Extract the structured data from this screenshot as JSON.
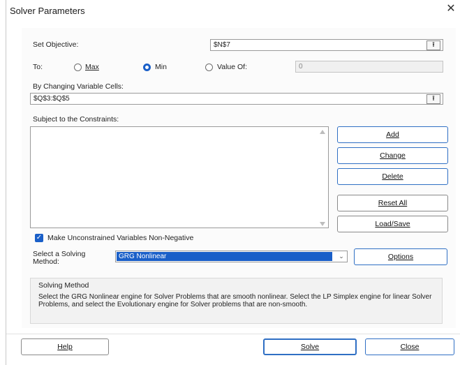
{
  "window": {
    "title": "Solver Parameters",
    "close_glyph": "✕"
  },
  "objective": {
    "label": "Set Objective:",
    "value": "$N$7",
    "ref_icon": "range-select-icon"
  },
  "to": {
    "label": "To:",
    "options": [
      {
        "label": "Max",
        "selected": false
      },
      {
        "label": "Min",
        "selected": true
      },
      {
        "label": "Value Of:",
        "selected": false
      }
    ],
    "value_of": "0"
  },
  "changing_cells": {
    "label": "By Changing Variable Cells:",
    "value": "$Q$3:$Q$5"
  },
  "constraints": {
    "label": "Subject to the Constraints:",
    "items": []
  },
  "buttons": {
    "add": "Add",
    "change": "Change",
    "delete": "Delete",
    "reset_all": "Reset All",
    "load_save": "Load/Save",
    "options": "Options",
    "help": "Help",
    "solve": "Solve",
    "close": "Close"
  },
  "nonnegative": {
    "label": "Make Unconstrained Variables Non-Negative",
    "checked": true
  },
  "method": {
    "label_line1": "Select a Solving",
    "label_line2": "Method:",
    "selected": "GRG Nonlinear"
  },
  "solving_method": {
    "title": "Solving Method",
    "text": "Select the GRG Nonlinear engine for Solver Problems that are smooth nonlinear. Select the LP Simplex engine for linear Solver Problems, and select the Evolutionary engine for Solver problems that are non-smooth."
  },
  "colors": {
    "accent": "#1a5fc8",
    "button_border": "#2f6fc4"
  }
}
